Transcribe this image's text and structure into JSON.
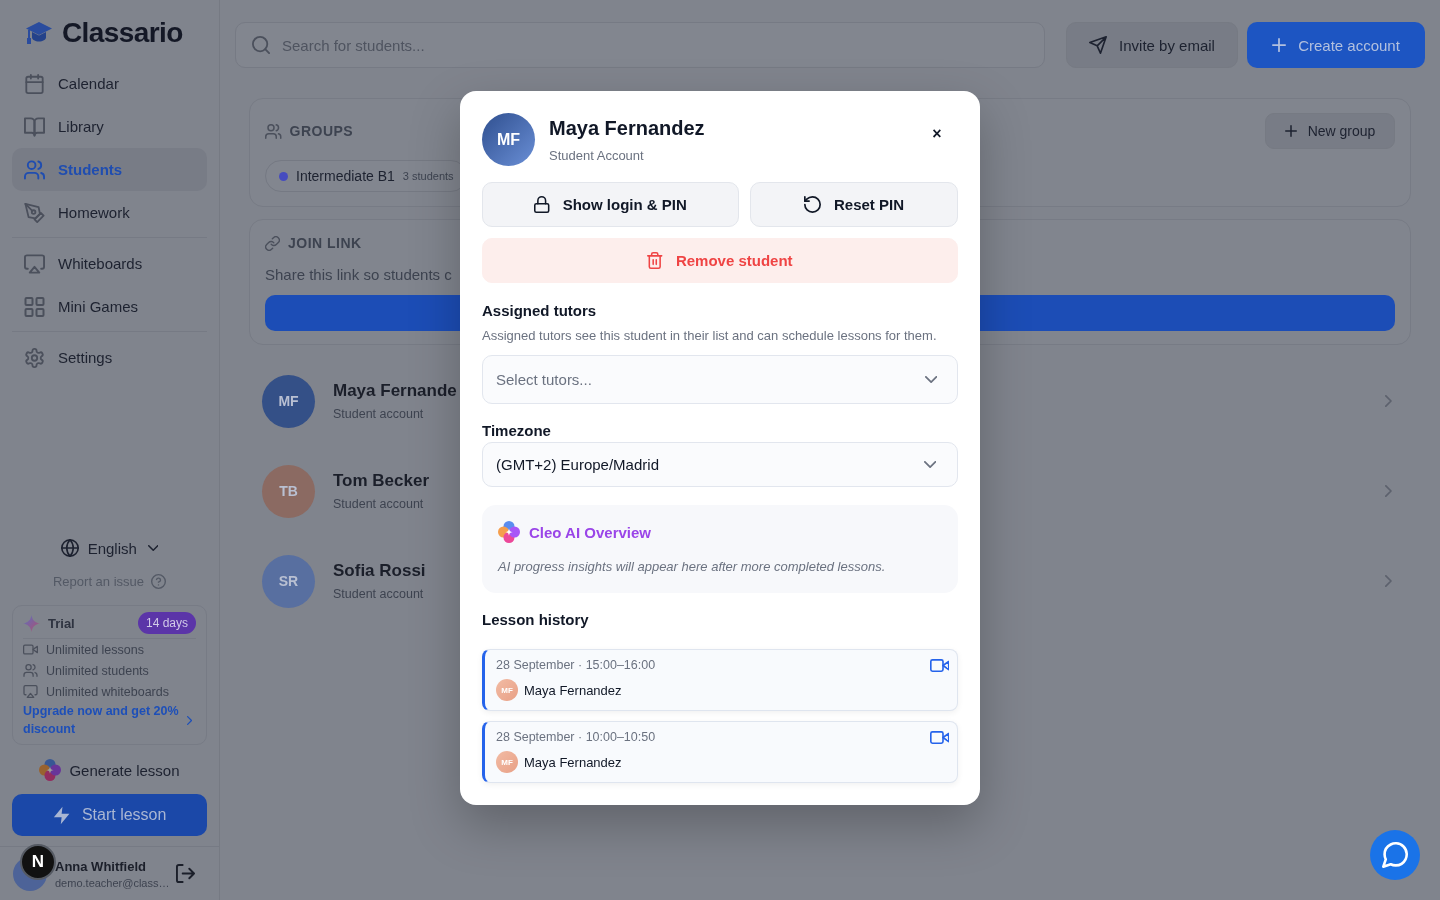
{
  "sidebar": {
    "brand": "Classario",
    "nav_sections": [
      {
        "items": [
          {
            "label": "Calendar",
            "selected": false
          },
          {
            "label": "Library",
            "selected": false
          },
          {
            "label": "Students",
            "selected": true
          },
          {
            "label": "Homework",
            "selected": false
          }
        ]
      },
      {
        "items": [
          {
            "label": "Whiteboards",
            "selected": false
          },
          {
            "label": "Mini Games",
            "selected": false
          }
        ]
      },
      {
        "items": [
          {
            "label": "Settings",
            "selected": false
          }
        ]
      }
    ],
    "language": "English",
    "report_link": "Report an issue",
    "trial": {
      "title": "Trial",
      "badge": "14 days",
      "features": [
        "Unlimited lessons",
        "Unlimited students",
        "Unlimited whiteboards"
      ],
      "upgrade_link": "Upgrade now and get 20% discount"
    },
    "generate_button": "Generate lesson",
    "start_button": "Start lesson",
    "user": {
      "name": "Anna Whitfield",
      "email": "demo.teacher@class…"
    }
  },
  "dev_badge": "N",
  "main": {
    "search": {
      "placeholder": "Search for students..."
    },
    "buttons": [
      {
        "label": "Invite by email",
        "kind": "secondary"
      },
      {
        "label": "Create account",
        "kind": "primary"
      }
    ],
    "groups": {
      "title": "GROUPS",
      "button": "New group",
      "items": [
        {
          "name": "Intermediate B1",
          "count": "3 students"
        }
      ]
    },
    "join_link": {
      "title": "JOIN LINK",
      "text": "Share this link so students c"
    },
    "students": [
      {
        "initials": "MF",
        "name": "Maya Fernande",
        "subtitle": "Student account",
        "color": "#345087"
      },
      {
        "initials": "TB",
        "name": "Tom Becker",
        "subtitle": "Student account",
        "color": "#8b6a62"
      },
      {
        "initials": "SR",
        "name": "Sofia Rossi",
        "subtitle": "Student account",
        "color": "#586fa0"
      }
    ]
  },
  "dialog": {
    "avatar": "MF",
    "name": "Maya Fernandez",
    "subtitle": "Student Account",
    "close": "×",
    "actions": [
      {
        "label": "Show login & PIN",
        "kind": "secondary"
      },
      {
        "label": "Reset PIN",
        "kind": "secondary"
      },
      {
        "label": "Remove student",
        "kind": "danger"
      }
    ],
    "tutors": {
      "title": "Assigned tutors",
      "description": "Assigned tutors see this student in their list and can schedule lessons for them.",
      "placeholder": "Select tutors..."
    },
    "timezone": {
      "title": "Timezone",
      "value": "(GMT+2) Europe/Madrid"
    },
    "ai_overview": {
      "title": "Cleo AI Overview",
      "text": "AI progress insights will appear here after more completed lessons."
    },
    "history": {
      "title": "Lesson history",
      "lessons": [
        {
          "time": "28 September · 15:00–16:00",
          "initials": "MF",
          "student": "Maya Fernandez"
        },
        {
          "time": "28 September · 10:00–10:50",
          "initials": "MF",
          "student": "Maya Fernandez"
        }
      ]
    }
  }
}
